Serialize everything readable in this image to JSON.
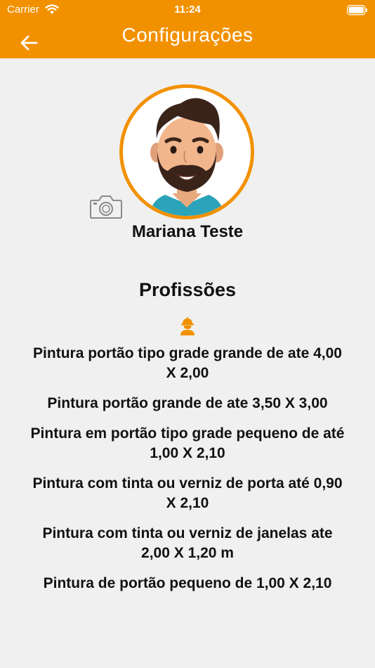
{
  "status_bar": {
    "carrier": "Carrier",
    "time": "11:24",
    "wifi_icon": "wifi-icon",
    "battery_icon": "battery-icon"
  },
  "header": {
    "title": "Configurações",
    "back_icon": "arrow-left-icon",
    "background_color": "#f29100"
  },
  "profile": {
    "name": "Mariana Teste",
    "avatar_icon": "bearded-man-avatar",
    "camera_icon": "camera-icon"
  },
  "professions": {
    "title": "Profissões",
    "icon": "worker-icon",
    "items": [
      "Pintura portão tipo grade grande de ate 4,00 X 2,00",
      "Pintura portão grande de ate 3,50 X 3,00",
      "Pintura em portão tipo grade pequeno de até 1,00 X 2,10",
      "Pintura com tinta ou verniz de porta até 0,90 X 2,10",
      "Pintura com tinta ou verniz de janelas ate 2,00 X 1,20 m",
      "Pintura de portão pequeno de 1,00 X 2,10"
    ]
  }
}
